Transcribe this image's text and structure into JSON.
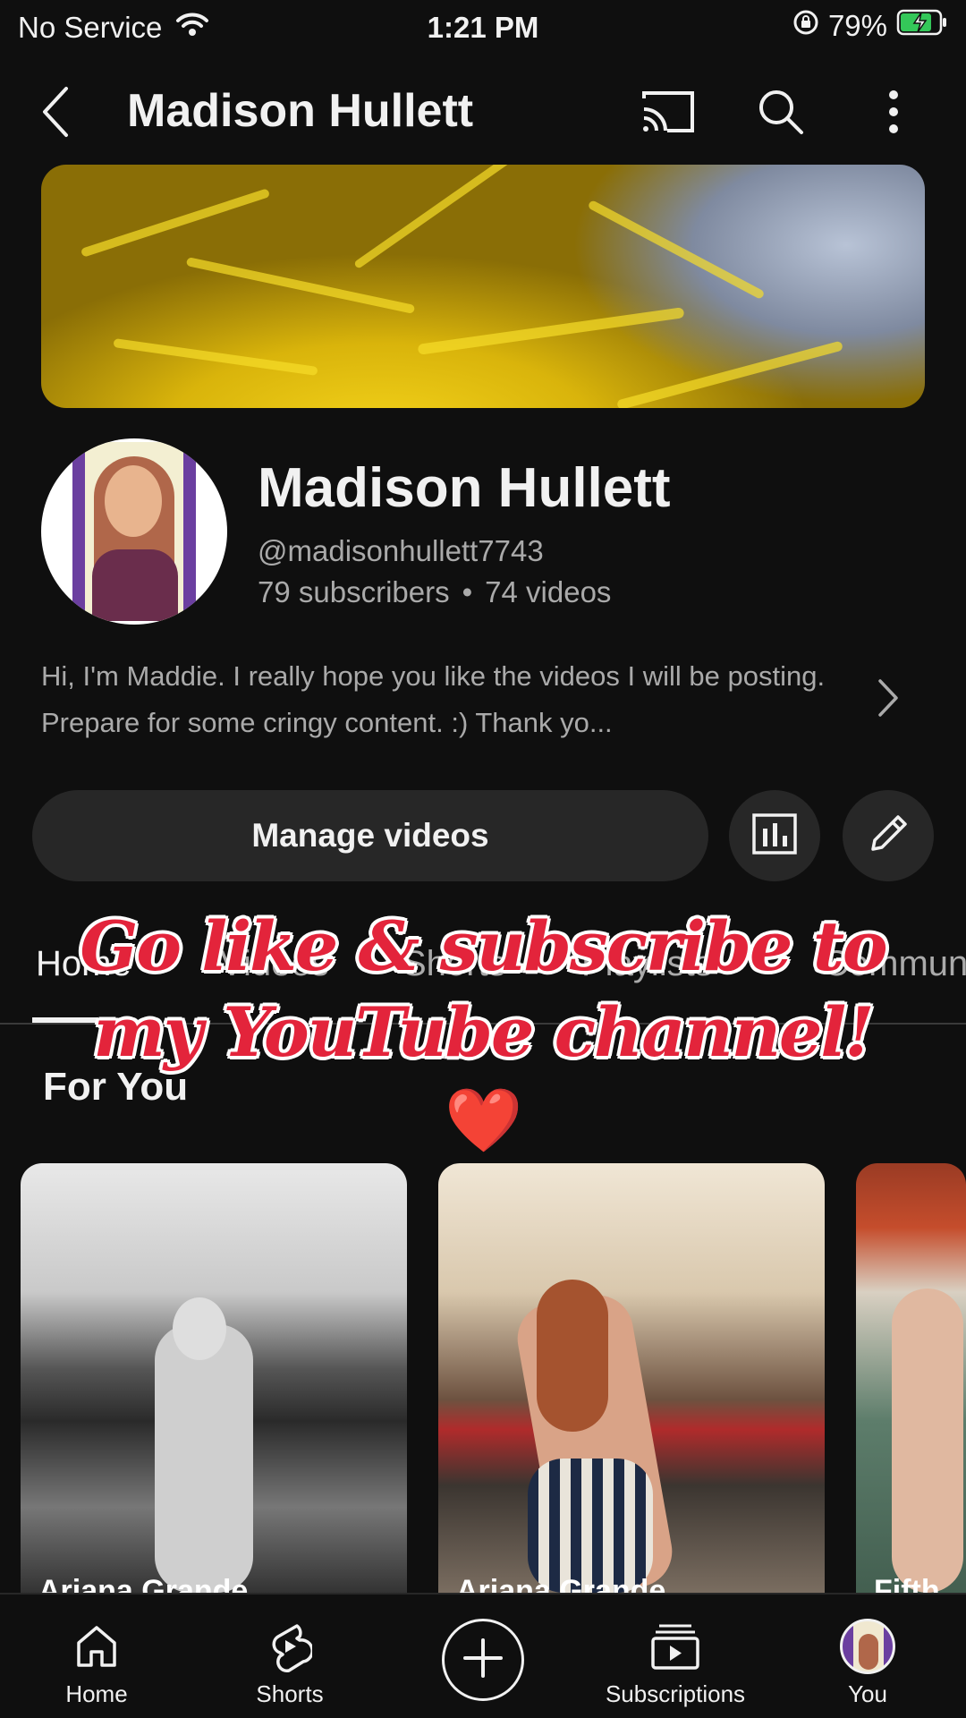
{
  "status_bar": {
    "carrier": "No Service",
    "time": "1:21 PM",
    "battery": "79%"
  },
  "header": {
    "title": "Madison Hullett",
    "icons": [
      "back-icon",
      "cast-icon",
      "search-icon",
      "more-icon"
    ]
  },
  "channel": {
    "name": "Madison Hullett",
    "handle": "@madisonhullett7743",
    "subscribers": "79 subscribers",
    "separator": "•",
    "videos": "74 videos",
    "description": "Hi, I'm Maddie. I really hope you like the videos I will be posting. Prepare for some cringy content. :) Thank yo..."
  },
  "actions": {
    "manage_label": "Manage videos",
    "icons": [
      "analytics-icon",
      "edit-pencil-icon"
    ]
  },
  "tabs": [
    {
      "label": "Home",
      "active": true
    },
    {
      "label": "Videos",
      "active": false
    },
    {
      "label": "Shorts",
      "active": false
    },
    {
      "label": "Playlists",
      "active": false
    },
    {
      "label": "Community",
      "active": false
    }
  ],
  "overlay": {
    "line1": "Go like & subscribe to",
    "line2": "my YouTube channel!",
    "emoji": "❤️"
  },
  "section": {
    "title": "For You"
  },
  "shorts": [
    {
      "caption": "Ariana Grande"
    },
    {
      "caption": "Ariana Grande"
    },
    {
      "caption": "Fifth"
    }
  ],
  "bottom_nav": [
    {
      "label": "Home",
      "icon": "home-icon"
    },
    {
      "label": "Shorts",
      "icon": "shorts-icon"
    },
    {
      "label": "",
      "icon": "create-plus-icon"
    },
    {
      "label": "Subscriptions",
      "icon": "subscriptions-icon"
    },
    {
      "label": "You",
      "icon": "you-avatar-icon"
    }
  ],
  "colors": {
    "background": "#0f0f0f",
    "surface": "#272727",
    "text_primary": "#f1f1f1",
    "text_secondary": "#aaaaaa",
    "overlay_red": "#e3243b",
    "battery_green": "#34c759"
  }
}
